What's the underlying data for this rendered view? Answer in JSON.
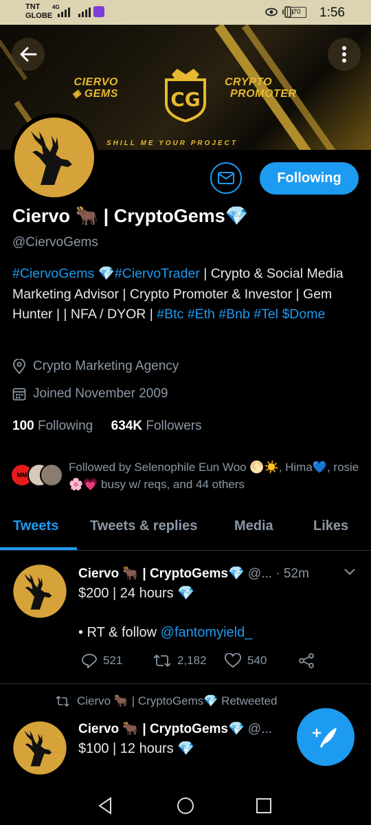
{
  "status_bar": {
    "carrier_1": "TNT",
    "carrier_2": "GLOBE",
    "network": "4G",
    "battery": "70",
    "time": "1:56"
  },
  "banner": {
    "left_line1": "CIERVO",
    "left_line2": "GEMS",
    "right_line1": "CRYPTO",
    "right_line2": "PROMOTER",
    "tagline": "SHILL ME YOUR PROJECT",
    "logo_text": "CG"
  },
  "profile": {
    "name": "Ciervo 🐂 | CryptoGems💎",
    "handle": "@CiervoGems",
    "bio_parts": {
      "tag1": "#CiervoGems",
      "gem": " 💎",
      "tag2": "#CiervoTrader",
      "text1": " | Crypto & Social Media Marketing Advisor | Crypto Promoter & Investor | Gem Hunter | | NFA / DYOR | ",
      "tag3": "#Btc",
      "tag4": "#Eth",
      "tag5": "#Bnb",
      "tag6": "#Tel",
      "tag7": "$Dome"
    },
    "location": "Crypto Marketing Agency",
    "joined": "Joined November 2009",
    "following_count": "100",
    "following_label": "Following",
    "followers_count": "634K",
    "followers_label": "Followers",
    "followed_by": "Followed by Selenophile Eun Woo 🌕☀️, Hima💙, rosie 🌸💗 busy w/ reqs, and 44 others",
    "follow_button": "Following",
    "mini_avatar_text": "MM"
  },
  "tabs": [
    {
      "label": "Tweets"
    },
    {
      "label": "Tweets & replies"
    },
    {
      "label": "Media"
    },
    {
      "label": "Likes"
    }
  ],
  "tweets": [
    {
      "name": "Ciervo 🐂 | CryptoGems💎",
      "handle": "@...",
      "time": "· 52m",
      "line1": "$200 | 24 hours 💎",
      "line2_prefix": "• RT & follow ",
      "line2_link": "@fantomyield_",
      "replies": "521",
      "retweets": "2,182",
      "likes": "540"
    },
    {
      "retweeted_by": "Ciervo 🐂 | CryptoGems💎 Retweeted",
      "name": "Ciervo 🐂 | CryptoGems💎",
      "handle": "@...",
      "line1": "$100 | 12 hours 💎"
    }
  ],
  "colors": {
    "accent": "#1d9bf0",
    "gold": "#e6b930",
    "background": "#000000",
    "muted": "#8b98a5"
  },
  "icons": [
    "back-arrow-icon",
    "more-vertical-icon",
    "mail-icon",
    "location-icon",
    "calendar-icon",
    "reply-icon",
    "retweet-icon",
    "like-icon",
    "share-icon",
    "compose-icon",
    "chevron-down-icon"
  ]
}
